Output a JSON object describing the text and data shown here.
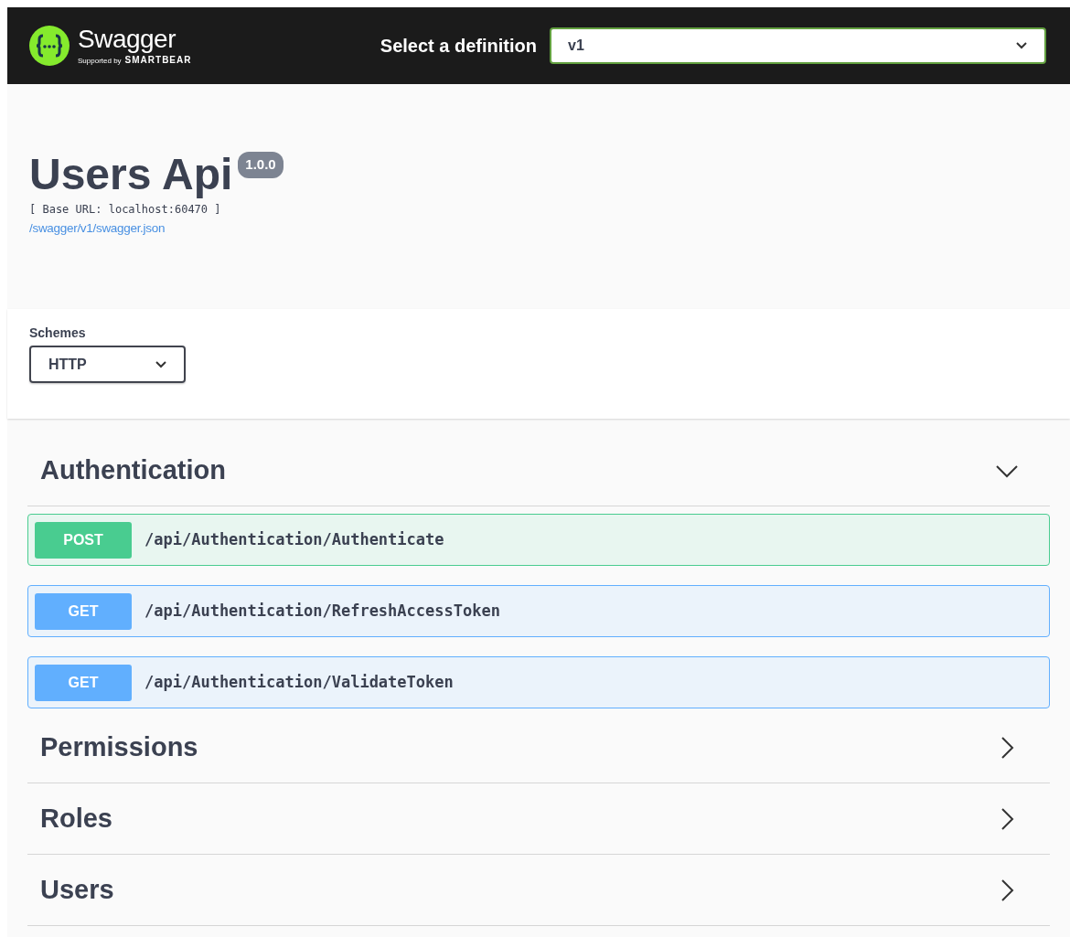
{
  "topbar": {
    "brand": "Swagger",
    "tagline_prefix": "Supported by",
    "tagline_brand": "SMARTBEAR",
    "select_label": "Select a definition",
    "select_value": "v1"
  },
  "info": {
    "title": "Users Api",
    "version": "1.0.0",
    "base_url": "[ Base URL: localhost:60470 ]",
    "spec_link": "/swagger/v1/swagger.json"
  },
  "schemes": {
    "label": "Schemes",
    "value": "HTTP"
  },
  "tags": [
    {
      "name": "Authentication",
      "expanded": true,
      "operations": [
        {
          "method": "POST",
          "path": "/api/Authentication/Authenticate"
        },
        {
          "method": "GET",
          "path": "/api/Authentication/RefreshAccessToken"
        },
        {
          "method": "GET",
          "path": "/api/Authentication/ValidateToken"
        }
      ]
    },
    {
      "name": "Permissions",
      "expanded": false
    },
    {
      "name": "Roles",
      "expanded": false
    },
    {
      "name": "Users",
      "expanded": false
    }
  ]
}
